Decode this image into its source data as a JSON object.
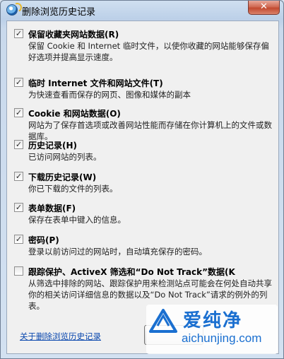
{
  "window": {
    "title": "删除浏览历史记录",
    "close_glyph": "✕"
  },
  "options": [
    {
      "checked": true,
      "title": "保留收藏夹网站数据(R)",
      "description": "保留 Cookie 和 Internet 临时文件，以使你收藏的网站能够保存偏好选项并提高显示速度。"
    },
    {
      "checked": true,
      "title": "临时 Internet 文件和网站文件(T)",
      "description": "为快速查看而保存的网页、图像和媒体的副本"
    },
    {
      "checked": true,
      "title": "Cookie 和网站数据(O)",
      "description": "网站为了保存首选项或改善网站性能而存储在你计算机上的文件或数据库。"
    },
    {
      "checked": true,
      "title": "历史记录(H)",
      "description": "已访问网站的列表。"
    },
    {
      "checked": true,
      "title": "下载历史记录(W)",
      "description": "你已下载的文件的列表。"
    },
    {
      "checked": true,
      "title": "表单数据(F)",
      "description": "保存在表单中键入的信息。"
    },
    {
      "checked": true,
      "title": "密码(P)",
      "description": "登录以前访问过的网站时，自动填充保存的密码。"
    },
    {
      "checked": false,
      "title": "跟踪保护、ActiveX 筛选和“Do Not Track”数据(K",
      "description": "从筛选中排除的网站、跟踪保护用来检测站点可能会在何处自动共享你的相关访问详细信息的数据以及“Do Not Track”请求的例外的列表。"
    }
  ],
  "footer": {
    "link_label": "关于删除浏览历史记录"
  },
  "watermark": {
    "brand": "爱纯净",
    "url": "aichunjing.com",
    "color": "#1a6fd0"
  }
}
